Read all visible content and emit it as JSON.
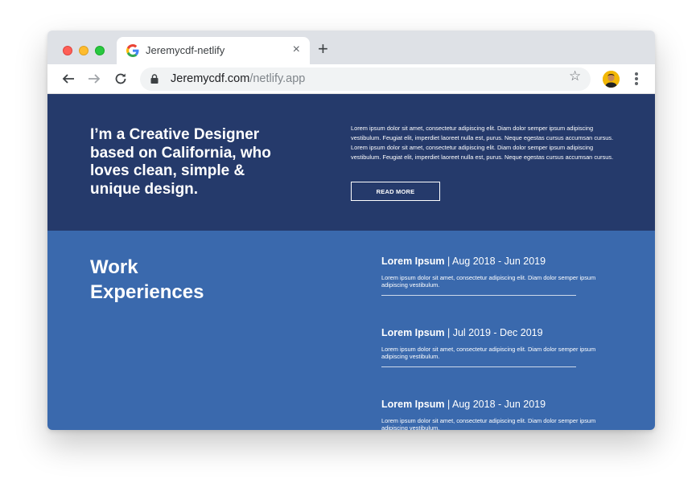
{
  "browser": {
    "tab_title": "Jeremycdf-netlify",
    "url_domain": "Jeremycdf.com",
    "url_path": "/netlify.app",
    "close_glyph": "×",
    "new_tab_glyph": "+",
    "bookmark_glyph": "☆"
  },
  "hero": {
    "heading": "I’m a Creative Designer based on California, who loves clean, simple & unique design.",
    "body": "Lorem ipsum dolor sit amet, consectetur adipiscing elit. Diam dolor semper ipsum adipiscing vestibulum. Feugiat elit, imperdiet laoreet nulla est, purus. Neque egestas cursus accumsan cursus. Lorem ipsum dolor sit amet, consectetur adipiscing elit. Diam dolor semper ipsum adipiscing vestibulum. Feugiat elit, imperdiet laoreet nulla est, purus. Neque egestas cursus accumsan cursus.",
    "button_label": "READ MORE"
  },
  "work": {
    "title": "Work Experiences",
    "items": [
      {
        "company": "Lorem Ipsum",
        "period": " | Aug 2018 - Jun 2019",
        "description": "Lorem ipsum dolor sit amet, consectetur adipiscing elit. Diam dolor semper ipsum adipiscing vestibulum."
      },
      {
        "company": "Lorem Ipsum",
        "period": " | Jul 2019 - Dec 2019",
        "description": "Lorem ipsum dolor sit amet, consectetur adipiscing elit. Diam dolor semper ipsum adipiscing vestibulum."
      },
      {
        "company": "Lorem Ipsum",
        "period": " | Aug 2018 - Jun 2019",
        "description": "Lorem ipsum dolor sit amet, consectetur adipiscing elit. Diam dolor semper ipsum adipiscing vestibulum."
      }
    ]
  },
  "colors": {
    "hero_bg": "#253a6b",
    "work_bg": "#3a69ad",
    "tabstrip_bg": "#dee1e6"
  }
}
